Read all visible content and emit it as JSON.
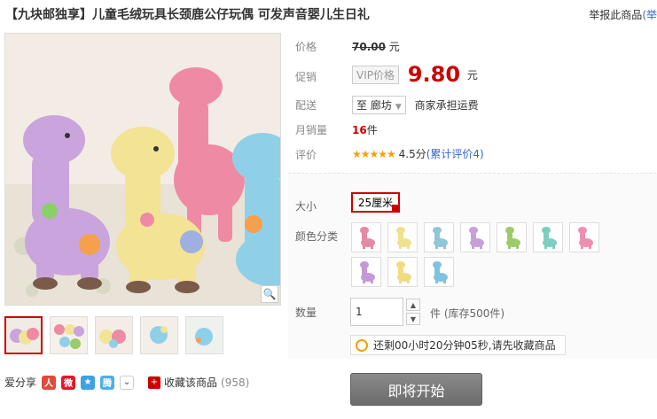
{
  "title": "【九块邮独享】儿童毛绒玩具长颈鹿公仔玩偶 可发声音婴儿生日礼",
  "report": "举报此商品",
  "report_ext": "(举",
  "price": {
    "label": "价格",
    "original": "70.00",
    "unit": "元"
  },
  "promo": {
    "label": "促销",
    "vip": "VIP价格",
    "price": "9.80",
    "unit": "元"
  },
  "shipping": {
    "label": "配送",
    "to": "至",
    "city": "廊坊",
    "note": "商家承担运费"
  },
  "monthly_sales": {
    "label": "月销量",
    "value": "16",
    "unit": "件"
  },
  "rating": {
    "label": "评价",
    "stars": "★★★★★",
    "score": "4.5分",
    "reviews": "(累计评价4)"
  },
  "size": {
    "label": "大小",
    "selected": "25厘米"
  },
  "color": {
    "label": "颜色分类",
    "swatches": [
      "#e58aa4",
      "#f0e18c",
      "#8fc6d8",
      "#c8a0d8",
      "#9acd6a",
      "#7ccfc0",
      "#ef8fb0",
      "#c39ad8",
      "#f0dc7e",
      "#7fc2e0"
    ]
  },
  "quantity": {
    "label": "数量",
    "value": "1",
    "unit": "件",
    "stock": "(库存500件)"
  },
  "notice": "还剩00小时20分钟05秒,请先收藏商品",
  "buy_button": "即将开始",
  "share": {
    "label": "爱分享"
  },
  "favorite": {
    "label": "收藏该商品",
    "count": "(958)"
  }
}
